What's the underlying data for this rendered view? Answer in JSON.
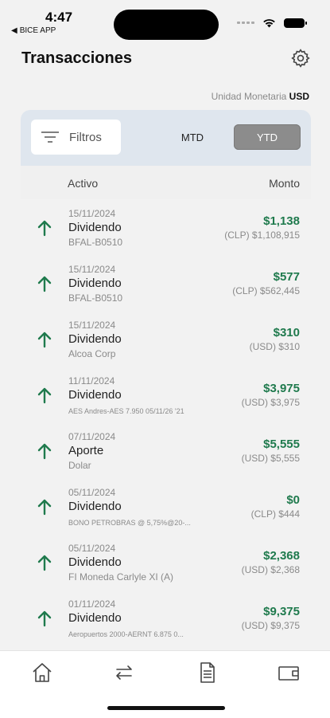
{
  "status_bar": {
    "time": "4:47",
    "back_app": "BICE APP"
  },
  "header": {
    "title": "Transacciones",
    "settings_icon": "gear-icon"
  },
  "currency": {
    "label": "Unidad Monetaria",
    "value": "USD"
  },
  "filters": {
    "label": "Filtros",
    "segments": [
      "MTD",
      "YTD"
    ],
    "selected": "YTD"
  },
  "table_header": {
    "asset": "Activo",
    "amount": "Monto"
  },
  "transactions": [
    {
      "date": "15/11/2024",
      "type": "Dividendo",
      "instrument": "BFAL-B0510",
      "amount": "$1,138",
      "sub": "(CLP) $1,108,915"
    },
    {
      "date": "15/11/2024",
      "type": "Dividendo",
      "instrument": "BFAL-B0510",
      "amount": "$577",
      "sub": "(CLP) $562,445"
    },
    {
      "date": "15/11/2024",
      "type": "Dividendo",
      "instrument": "Alcoa Corp",
      "amount": "$310",
      "sub": "(USD) $310"
    },
    {
      "date": "11/11/2024",
      "type": "Dividendo",
      "instrument": "AES Andres-AES 7.950 05/11/26 '21",
      "amount": "$3,975",
      "sub": "(USD) $3,975"
    },
    {
      "date": "07/11/2024",
      "type": "Aporte",
      "instrument": "Dolar",
      "amount": "$5,555",
      "sub": "(USD) $5,555"
    },
    {
      "date": "05/11/2024",
      "type": "Dividendo",
      "instrument": "BONO PETROBRAS @ 5,75%@20-...",
      "amount": "$0",
      "sub": "(CLP) $444"
    },
    {
      "date": "05/11/2024",
      "type": "Dividendo",
      "instrument": "FI Moneda Carlyle XI (A)",
      "amount": "$2,368",
      "sub": "(USD) $2,368"
    },
    {
      "date": "01/11/2024",
      "type": "Dividendo",
      "instrument": "Aeropuertos 2000-AERNT 6.875 0...",
      "amount": "$9,375",
      "sub": "(USD) $9,375"
    }
  ],
  "tab_bar": [
    "home-icon",
    "transfer-icon",
    "document-icon",
    "wallet-icon"
  ],
  "colors": {
    "accent_green": "#1f7a4d",
    "segment_selected": "#8c8c8c",
    "panel_bg": "#dfe6ee"
  }
}
